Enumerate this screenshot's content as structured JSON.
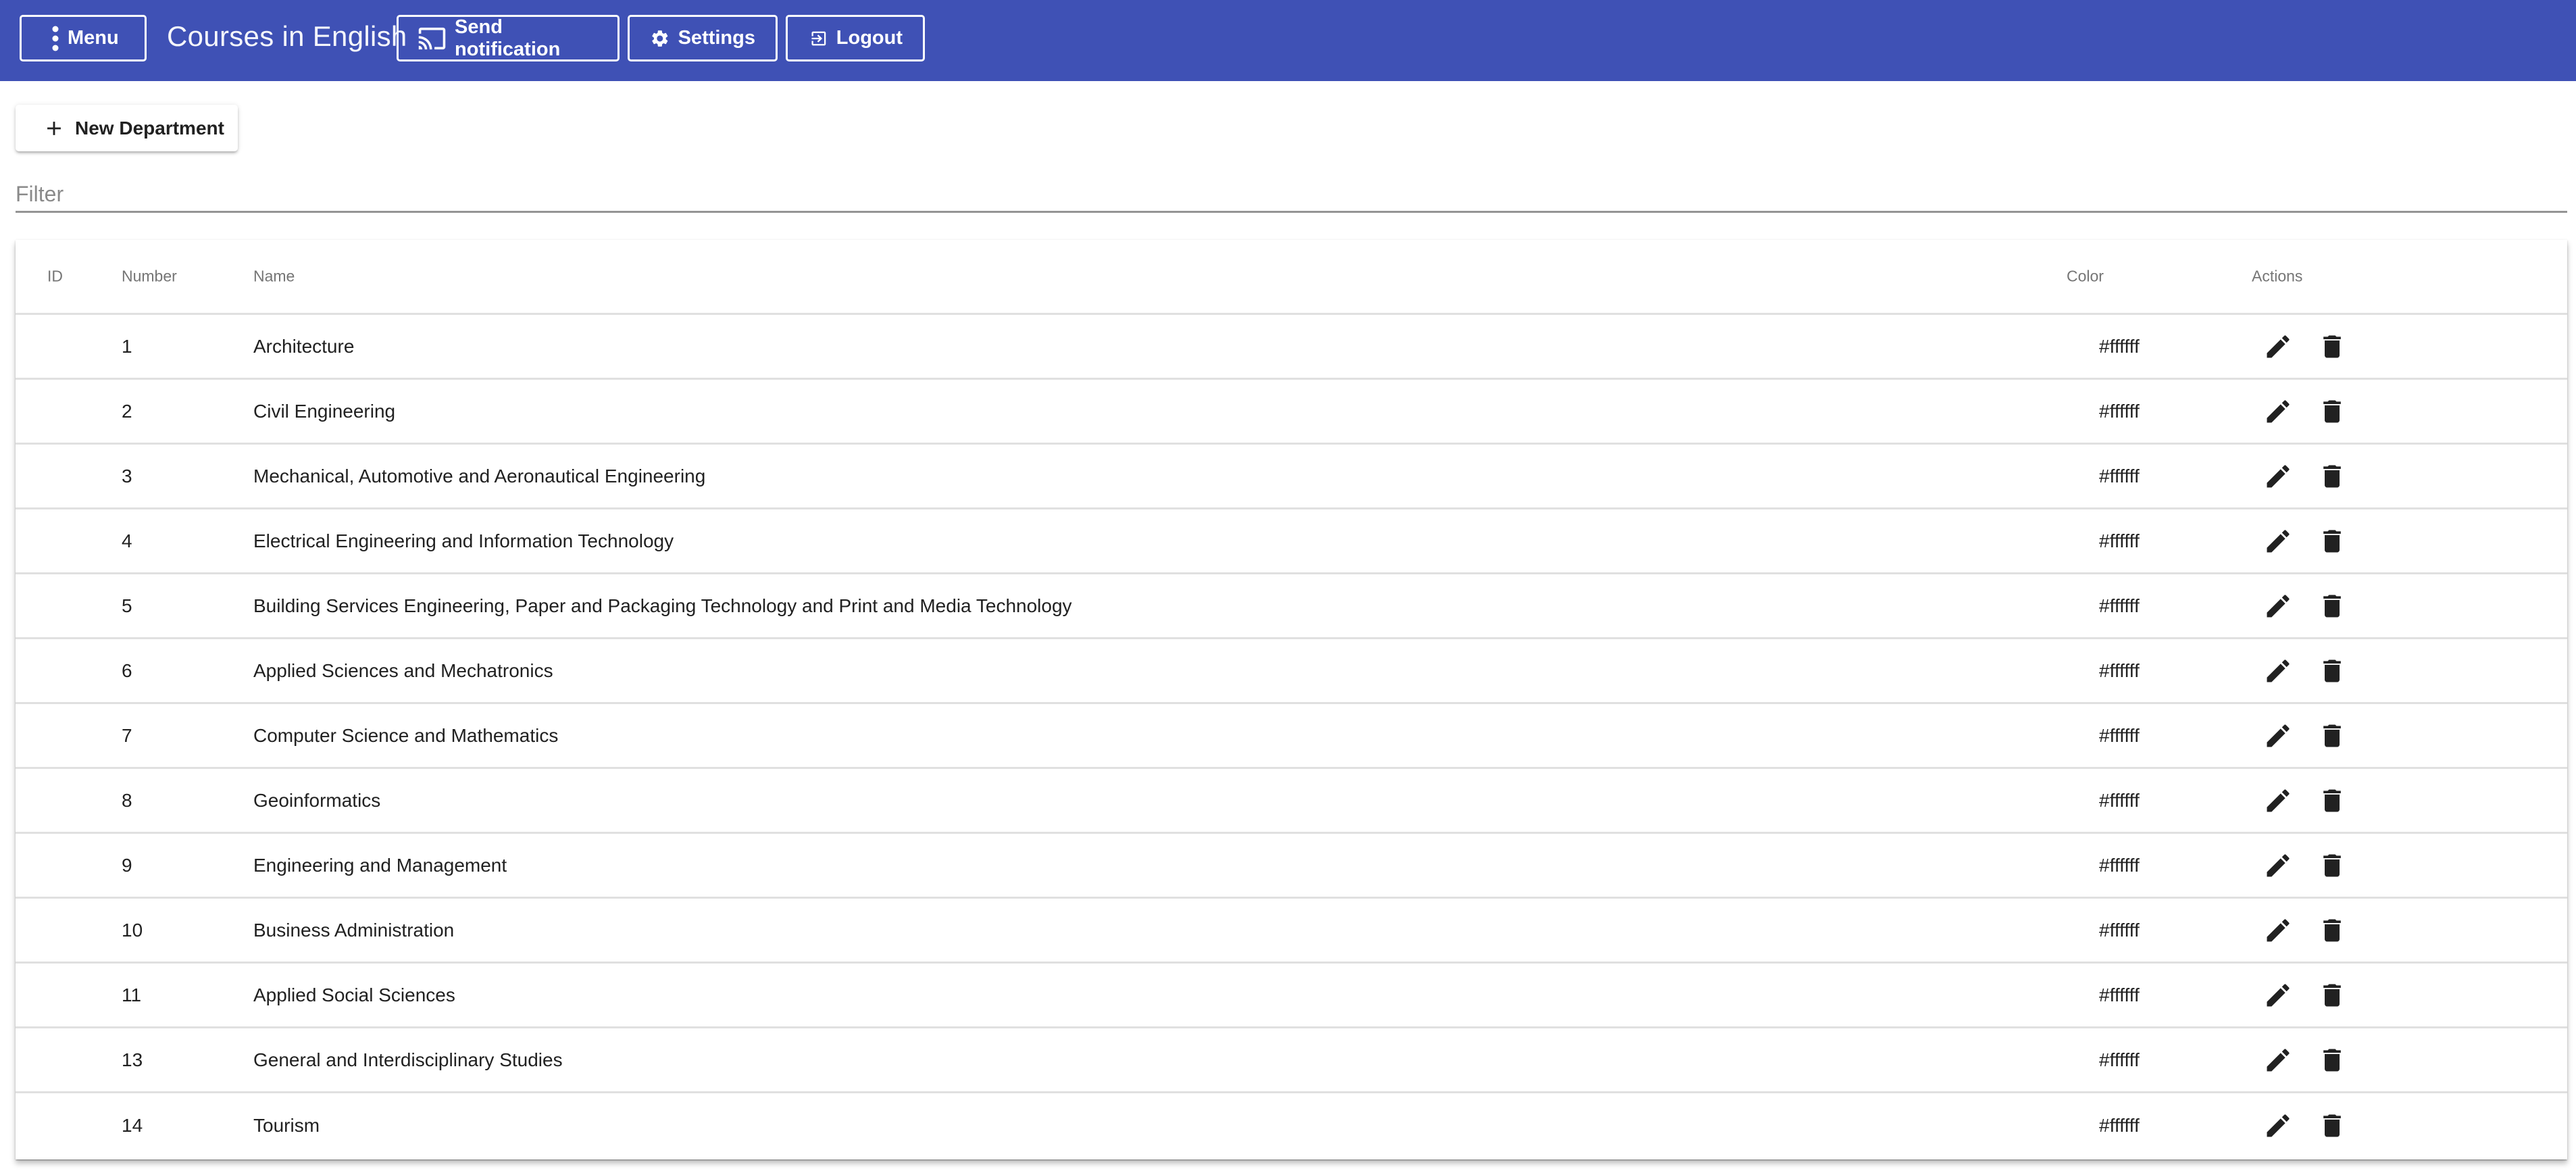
{
  "toolbar": {
    "menu_label": "Menu",
    "title": "Courses in English",
    "send_notification_label": "Send notification",
    "settings_label": "Settings",
    "logout_label": "Logout",
    "background_color": "#3f51b5"
  },
  "actions": {
    "new_department_label": "New Department"
  },
  "filter": {
    "placeholder": "Filter",
    "value": ""
  },
  "table": {
    "columns": {
      "id": "ID",
      "number": "Number",
      "name": "Name",
      "color": "Color",
      "actions": "Actions"
    },
    "rows": [
      {
        "id": "",
        "number": "1",
        "name": "Architecture",
        "color": "#ffffff"
      },
      {
        "id": "",
        "number": "2",
        "name": "Civil Engineering",
        "color": "#ffffff"
      },
      {
        "id": "",
        "number": "3",
        "name": "Mechanical, Automotive and Aeronautical Engineering",
        "color": "#ffffff"
      },
      {
        "id": "",
        "number": "4",
        "name": "Electrical Engineering and Information Technology",
        "color": "#ffffff"
      },
      {
        "id": "",
        "number": "5",
        "name": "Building Services Engineering, Paper and Packaging Technology and Print and Media Technology",
        "color": "#ffffff"
      },
      {
        "id": "",
        "number": "6",
        "name": "Applied Sciences and Mechatronics",
        "color": "#ffffff"
      },
      {
        "id": "",
        "number": "7",
        "name": "Computer Science and Mathematics",
        "color": "#ffffff"
      },
      {
        "id": "",
        "number": "8",
        "name": "Geoinformatics",
        "color": "#ffffff"
      },
      {
        "id": "",
        "number": "9",
        "name": "Engineering and Management",
        "color": "#ffffff"
      },
      {
        "id": "",
        "number": "10",
        "name": "Business Administration",
        "color": "#ffffff"
      },
      {
        "id": "",
        "number": "11",
        "name": "Applied Social Sciences",
        "color": "#ffffff"
      },
      {
        "id": "",
        "number": "13",
        "name": "General and Interdisciplinary Studies",
        "color": "#ffffff"
      },
      {
        "id": "",
        "number": "14",
        "name": "Tourism",
        "color": "#ffffff"
      }
    ],
    "row_action_icons": [
      "edit-icon",
      "delete-icon"
    ]
  }
}
